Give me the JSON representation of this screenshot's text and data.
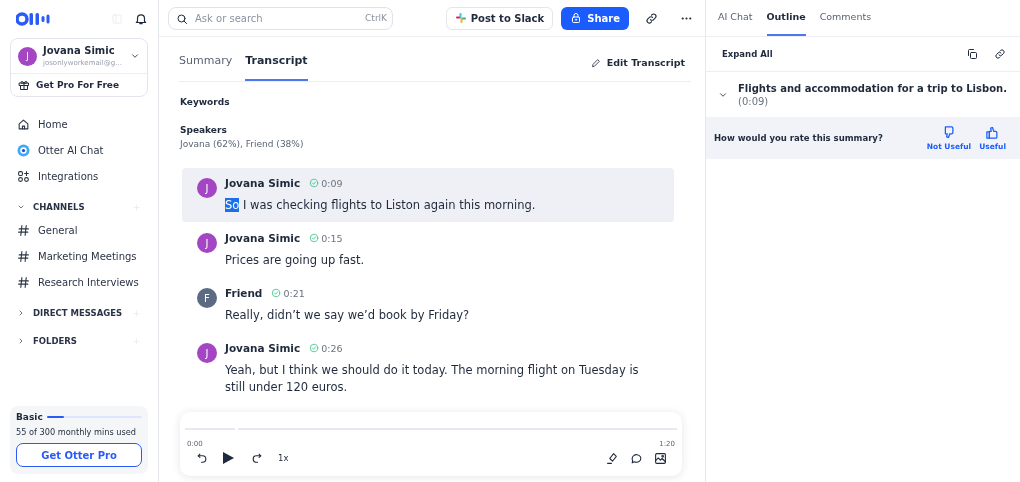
{
  "sidebar": {
    "account": {
      "initial": "J",
      "name": "Jovana Simic",
      "email": "josonlyworkemail@g…",
      "color": "#a446c4"
    },
    "promo": "Get Pro For Free",
    "nav": [
      {
        "kind": "home",
        "label": "Home"
      },
      {
        "kind": "chat",
        "label": "Otter AI Chat"
      },
      {
        "kind": "integrations",
        "label": "Integrations"
      }
    ],
    "sections": [
      {
        "label": "CHANNELS",
        "expanded": true,
        "items": [
          {
            "label": "General"
          },
          {
            "label": "Marketing Meetings"
          },
          {
            "label": "Research Interviews"
          }
        ]
      },
      {
        "label": "DIRECT MESSAGES",
        "expanded": false
      },
      {
        "label": "FOLDERS",
        "expanded": false
      }
    ],
    "plan": {
      "name": "Basic",
      "level": 0.18,
      "usage": "55 of 300 monthly mins used",
      "upgrade": "Get Otter Pro"
    }
  },
  "topbar": {
    "search": {
      "placeholder": "Ask or search",
      "shortcut": "CtrlK"
    },
    "slack_button": "Post to Slack",
    "share_button": "Share"
  },
  "tabs": [
    {
      "label": "Summary",
      "selected": false
    },
    {
      "label": "Transcript",
      "selected": true
    }
  ],
  "edit_button": "Edit Transcript",
  "keywords_heading": "Keywords",
  "speakers_heading": "Speakers",
  "speakers": "Jovana (62%), Friend (38%)",
  "transcript": [
    {
      "initial": "J",
      "color": "#a446c4",
      "speaker": "Jovana Simic",
      "time": "0:09",
      "active": true,
      "parts": [
        {
          "text": "So",
          "selected": true
        },
        {
          "text": " I was checking flights to Liston again this morning.",
          "selected": false
        }
      ]
    },
    {
      "initial": "J",
      "color": "#a446c4",
      "speaker": "Jovana Simic",
      "time": "0:15",
      "active": false,
      "parts": [
        {
          "text": "Prices are going up fast.",
          "selected": false
        }
      ]
    },
    {
      "initial": "F",
      "color": "#5c6b82",
      "speaker": "Friend",
      "time": "0:21",
      "active": false,
      "parts": [
        {
          "text": "Really, didn’t we say we’d book by Friday?",
          "selected": false
        }
      ]
    },
    {
      "initial": "J",
      "color": "#a446c4",
      "speaker": "Jovana Simic",
      "time": "0:26",
      "active": false,
      "parts": [
        {
          "text": "Yeah, but I think we should do it today. The morning flight on Tuesday is still under 120 euros.",
          "selected": false
        }
      ]
    }
  ],
  "player": {
    "start": "0:00",
    "end": "1:20",
    "speed": "1x"
  },
  "right_tabs": [
    {
      "label": "AI Chat",
      "selected": false
    },
    {
      "label": "Outline",
      "selected": true
    },
    {
      "label": "Comments",
      "selected": false
    }
  ],
  "outline": {
    "expand_all": "Expand All",
    "items": [
      {
        "title": "Flights and accommodation for a trip to Lisbon.",
        "time": "(0:09)",
        "expanded": true
      }
    ]
  },
  "rating": {
    "question": "How would you rate this summary?",
    "not_useful": "Not Useful",
    "useful": "Useful"
  }
}
